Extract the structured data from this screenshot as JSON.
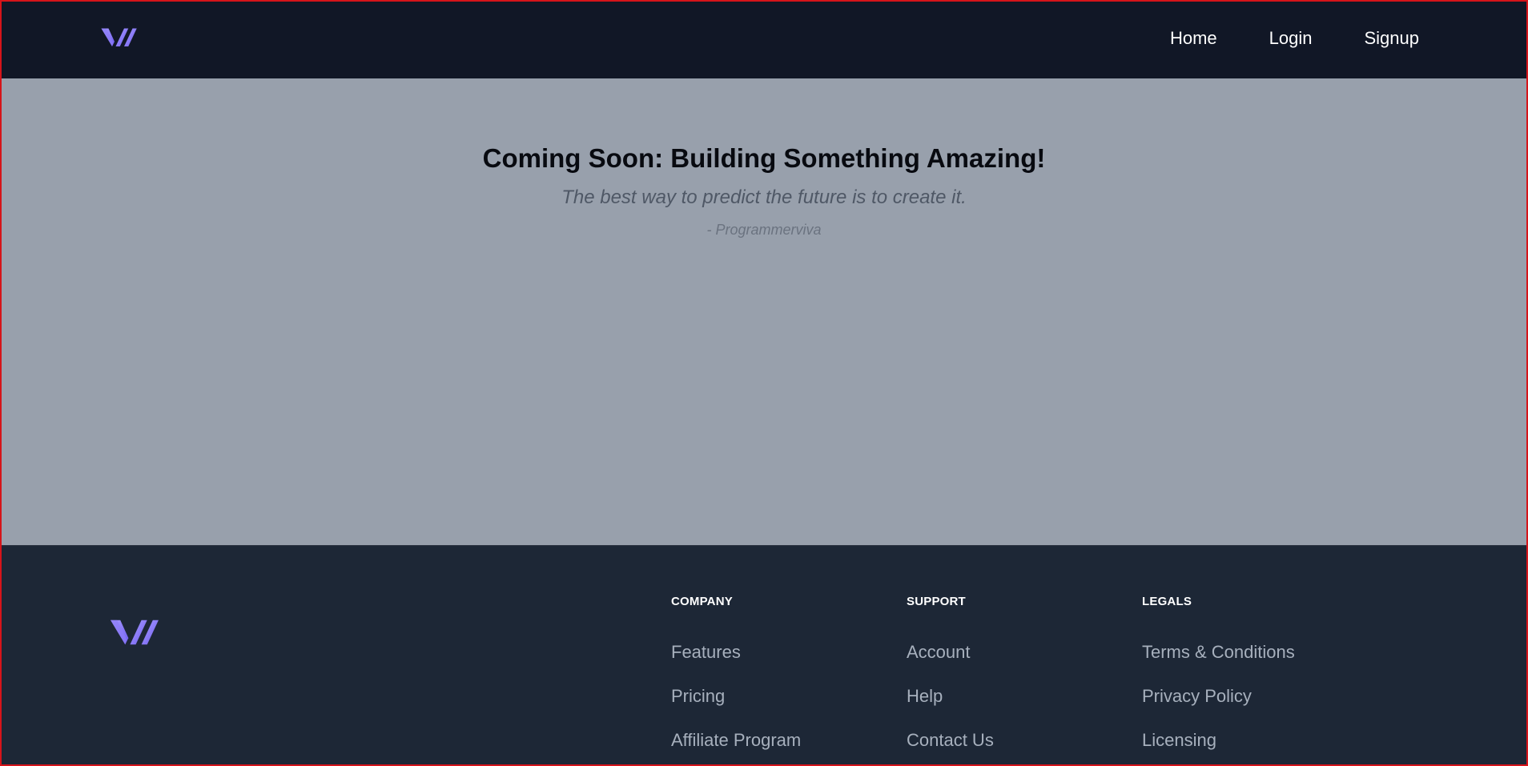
{
  "header": {
    "logo_icon": "brand-logo-icon",
    "nav": [
      {
        "label": "Home"
      },
      {
        "label": "Login"
      },
      {
        "label": "Signup"
      }
    ]
  },
  "main": {
    "headline": "Coming Soon: Building Something Amazing!",
    "quote": "The best way to predict the future is to create it.",
    "author": "- Programmerviva"
  },
  "footer": {
    "columns": [
      {
        "title": "COMPANY",
        "links": [
          "Features",
          "Pricing",
          "Affiliate Program"
        ]
      },
      {
        "title": "SUPPORT",
        "links": [
          "Account",
          "Help",
          "Contact Us"
        ]
      },
      {
        "title": "LEGALS",
        "links": [
          "Terms & Conditions",
          "Privacy Policy",
          "Licensing"
        ]
      }
    ]
  },
  "colors": {
    "header_bg": "#111726",
    "main_bg": "#98a0ac",
    "footer_bg": "#1d2736",
    "logo_accent": "#8b7cf6",
    "frame_border": "#d6141a"
  }
}
